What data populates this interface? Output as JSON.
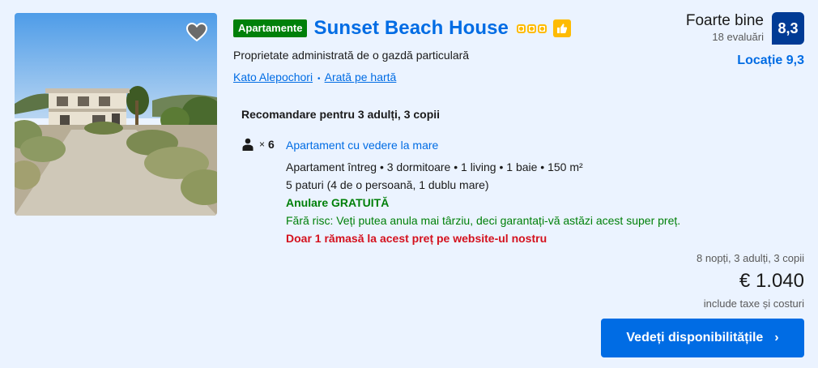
{
  "property": {
    "type_badge": "Apartamente",
    "name": "Sunset Beach House",
    "star_count": 3,
    "host_note": "Proprietate administrată de o gazdă particulară",
    "location": "Kato Alepochori",
    "map_link": "Arată pe hartă"
  },
  "review": {
    "word": "Foarte bine",
    "count": "18 evaluări",
    "score": "8,3",
    "location_score": "Locație 9,3"
  },
  "recommendation": {
    "title": "Recomandare pentru 3 adulți, 3 copii",
    "occupancy_times": "×",
    "occupancy_count": "6",
    "unit_name": "Apartament cu vedere la mare",
    "unit_details": "Apartament întreg • 3 dormitoare • 1 living • 1 baie • 150 m²",
    "beds": "5 paturi (4 de o persoană, 1 dublu mare)",
    "cancellation": "Anulare GRATUITĂ",
    "no_risk": "Fără risc: Veți putea anula mai târziu, deci garantați-vă astăzi acest super preț.",
    "scarcity": "Doar 1 rămasă la acest preț pe website-ul nostru"
  },
  "pricing": {
    "stay_summary": "8 nopți, 3 adulți, 3 copii",
    "price": "€ 1.040",
    "taxes_note": "include taxe și costuri",
    "cta_label": "Vedeți disponibilitățile",
    "cta_chevron": "›"
  },
  "icons": {
    "favorite": "heart-icon",
    "rating_stars": "star-icon",
    "preferred": "thumbs-up-icon",
    "occupancy": "person-icon",
    "cta": "chevron-right-icon"
  },
  "colors": {
    "brand_blue": "#006ce4",
    "score_navy": "#003b95",
    "success_green": "#008009",
    "alert_red": "#d4111e",
    "star_yellow": "#febb02",
    "background": "#ebf3ff"
  }
}
